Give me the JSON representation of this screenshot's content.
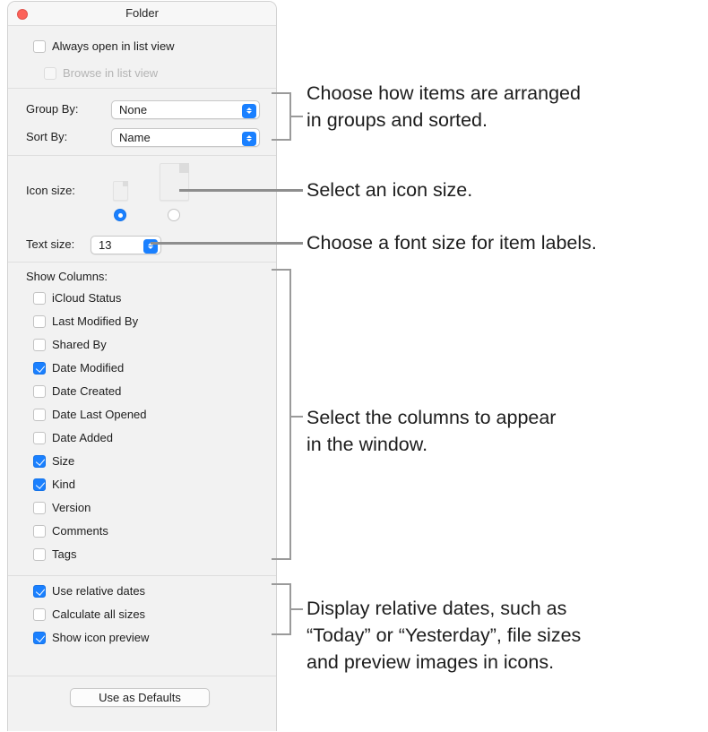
{
  "window": {
    "title": "Folder",
    "close_icon": "close-button-red"
  },
  "view_options": {
    "always_open_in_list_view": {
      "label": "Always open in list view",
      "checked": false,
      "enabled": true
    },
    "browse_in_list_view": {
      "label": "Browse in list view",
      "checked": false,
      "enabled": false
    }
  },
  "arrange": {
    "group_by": {
      "label": "Group By:",
      "value": "None"
    },
    "sort_by": {
      "label": "Sort By:",
      "value": "Name"
    }
  },
  "icon_size": {
    "label": "Icon size:",
    "small_icon": "document-icon-small",
    "large_icon": "document-icon-large",
    "selected": "small",
    "stepper_icon": "chevron-up-down-icon"
  },
  "text_size": {
    "label": "Text size:",
    "value": "13"
  },
  "show_columns": {
    "label": "Show Columns:",
    "items": [
      {
        "label": "iCloud Status",
        "checked": false
      },
      {
        "label": "Last Modified By",
        "checked": false
      },
      {
        "label": "Shared By",
        "checked": false
      },
      {
        "label": "Date Modified",
        "checked": true
      },
      {
        "label": "Date Created",
        "checked": false
      },
      {
        "label": "Date Last Opened",
        "checked": false
      },
      {
        "label": "Date Added",
        "checked": false
      },
      {
        "label": "Size",
        "checked": true
      },
      {
        "label": "Kind",
        "checked": true
      },
      {
        "label": "Version",
        "checked": false
      },
      {
        "label": "Comments",
        "checked": false
      },
      {
        "label": "Tags",
        "checked": false
      }
    ]
  },
  "display_options": {
    "items": [
      {
        "label": "Use relative dates",
        "checked": true
      },
      {
        "label": "Calculate all sizes",
        "checked": false
      },
      {
        "label": "Show icon preview",
        "checked": true
      }
    ]
  },
  "footer": {
    "use_as_defaults": "Use as Defaults"
  },
  "annotations": [
    {
      "text": "Choose how items are arranged\nin groups and sorted."
    },
    {
      "text": "Select an icon size."
    },
    {
      "text": "Choose a font size for item labels."
    },
    {
      "text": "Select the columns to appear\nin the window."
    },
    {
      "text": "Display relative dates, such as\n“Today” or “Yesterday”, file sizes\nand preview images in icons."
    }
  ],
  "colors": {
    "accent": "#1a80ff",
    "panel_bg": "#f2f2f2",
    "titlebar_bg": "#f7f7f7",
    "close_red": "#fc6259",
    "callout_gray": "#9a9a9a"
  }
}
